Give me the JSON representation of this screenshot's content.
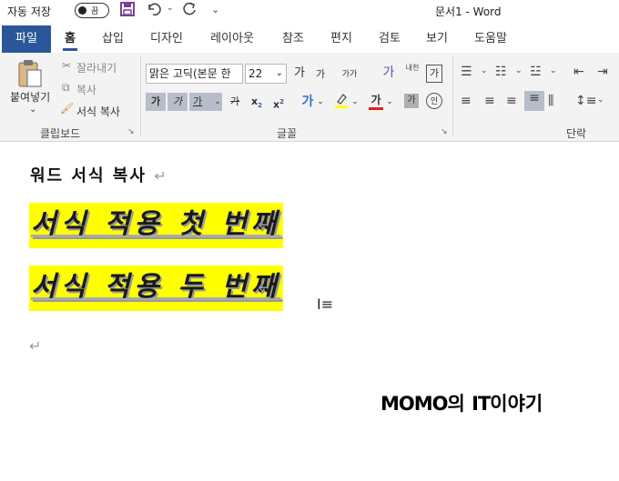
{
  "titlebar": {
    "autosave_label": "자동 저장",
    "toggle_state": "끔",
    "doc_title": "문서1  -  Word"
  },
  "tabs": [
    {
      "label": "파일"
    },
    {
      "label": "홈"
    },
    {
      "label": "삽입"
    },
    {
      "label": "디자인"
    },
    {
      "label": "레이아웃"
    },
    {
      "label": "참조"
    },
    {
      "label": "편지"
    },
    {
      "label": "검토"
    },
    {
      "label": "보기"
    },
    {
      "label": "도움말"
    }
  ],
  "clipboard": {
    "paste_label": "붙여넣기",
    "cut_label": "잘라내기",
    "copy_label": "복사",
    "format_painter_label": "서식 복사",
    "group_label": "클립보드"
  },
  "font": {
    "font_name": "맑은 고딕(본문 한",
    "font_size": "22",
    "grow_label": "가",
    "shrink_label": "가",
    "case_label": "가가",
    "bold_label": "가",
    "italic_label": "가",
    "underline_label": "가",
    "strike_label": "가",
    "subscript_label": "x",
    "superscript_label": "x",
    "effects_label": "가",
    "highlight_icon": "highlighter-icon",
    "font_color_label": "가",
    "shading_label": "가",
    "enclose_label": "인",
    "phonetic_label": "내천",
    "char_border_label": "가",
    "group_label": "글꼴"
  },
  "paragraph": {
    "group_label": "단락"
  },
  "document": {
    "heading": "워드 서식 복사",
    "lines": [
      "서식 적용 첫 번째",
      "서식 적용 두 번째"
    ],
    "para_mark": "↵",
    "watermark_caps1": "MOMO",
    "watermark_mid": "의 ",
    "watermark_caps2": "IT",
    "watermark_end": "이야기"
  },
  "colors": {
    "accent": "#2b579a",
    "highlight": "#ffff00",
    "qat": "#7a3f9b",
    "font_color_bar": "#e0201e",
    "highlight_bar": "#ffff00"
  }
}
